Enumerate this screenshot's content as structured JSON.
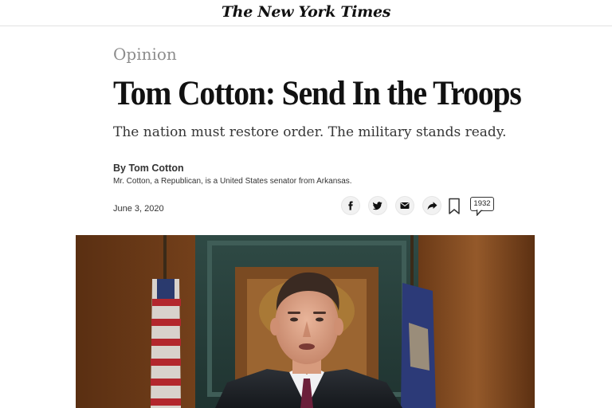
{
  "masthead": {
    "logo_text": "The New York Times"
  },
  "article": {
    "kicker": "Opinion",
    "headline": "Tom Cotton: Send In the Troops",
    "summary": "The nation must restore order. The military stands ready.",
    "byline": "By Tom Cotton",
    "bio": "Mr. Cotton, a Republican, is a United States senator from Arkansas.",
    "date": "June 3, 2020"
  },
  "share_toolbar": {
    "buttons": [
      {
        "icon": "facebook-icon"
      },
      {
        "icon": "twitter-icon"
      },
      {
        "icon": "email-icon"
      },
      {
        "icon": "share-icon"
      }
    ],
    "bookmark_icon": "bookmark-icon",
    "comment_count": "1932"
  },
  "colors": {
    "kicker": "#8d8d8d",
    "headline": "#111111",
    "text": "#333333",
    "button_bg": "#f2f2f2"
  },
  "lead_image": {
    "subject": "portrait-photo"
  }
}
